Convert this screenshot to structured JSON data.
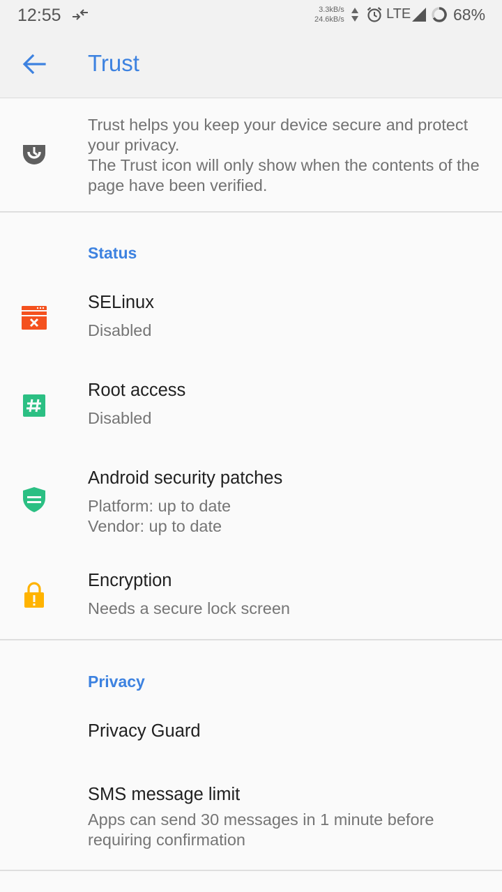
{
  "status_bar": {
    "time": "12:55",
    "speed_up": "3.3kB/s",
    "speed_down": "24.6kB/s",
    "network": "LTE",
    "battery": "68%"
  },
  "toolbar": {
    "title": "Trust"
  },
  "intro": {
    "line1": "Trust helps you keep your device secure and protect your privacy.",
    "line2": "The Trust icon will only show when the contents of the page have been verified."
  },
  "status_section": {
    "title": "Status",
    "items": [
      {
        "title": "SELinux",
        "summary": "Disabled",
        "icon": "selinux-icon",
        "color": "#f4511e"
      },
      {
        "title": "Root access",
        "summary": "Disabled",
        "icon": "hash-icon",
        "color": "#2bbf83"
      },
      {
        "title": "Android security patches",
        "summary_line1": "Platform: up to date",
        "summary_line2": "Vendor: up to date",
        "icon": "shield-icon",
        "color": "#2bbf83"
      },
      {
        "title": "Encryption",
        "summary": "Needs a secure lock screen",
        "icon": "lock-warning-icon",
        "color": "#ffb300"
      }
    ]
  },
  "privacy_section": {
    "title": "Privacy",
    "items": [
      {
        "title": "Privacy Guard"
      },
      {
        "title": "SMS message limit",
        "summary": "Apps can send 30 messages in 1 minute before requiring confirmation"
      }
    ]
  },
  "colors": {
    "accent": "#3d82e0",
    "background": "#fafafa"
  }
}
